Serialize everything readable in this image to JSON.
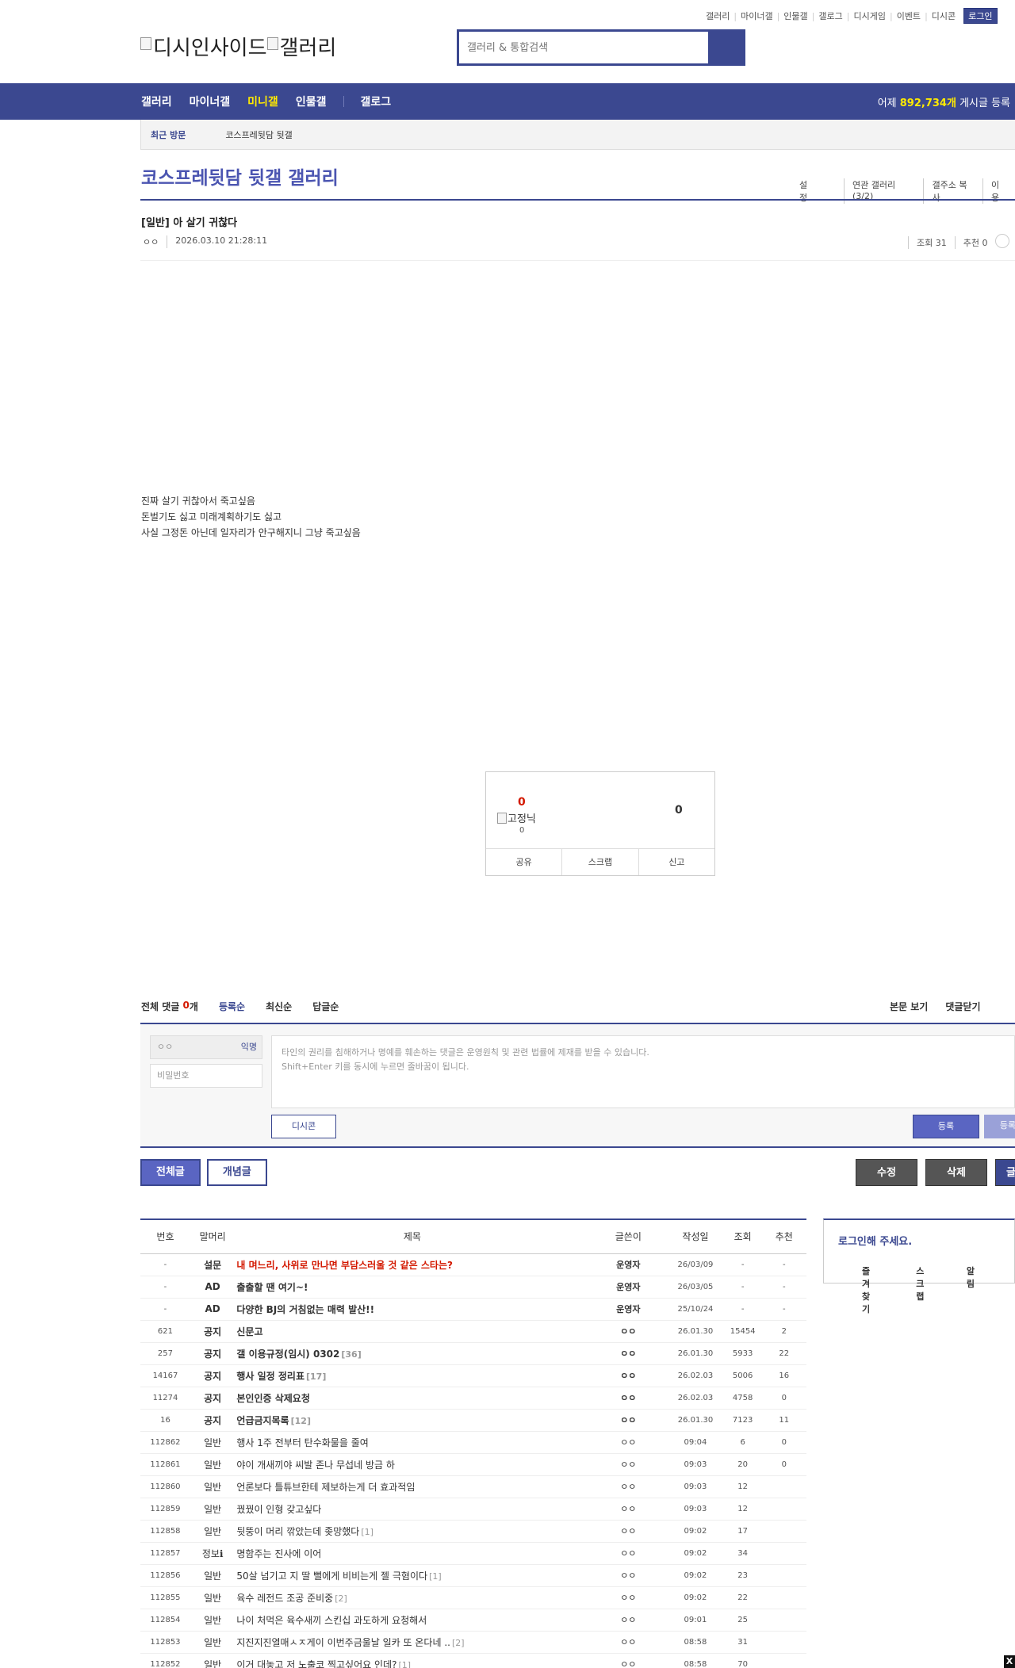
{
  "util_nav": {
    "items": [
      "갤러리",
      "마이너갤",
      "인물갤",
      "갤로그",
      "디시게임",
      "이벤트",
      "디시콘"
    ],
    "login": "로그인"
  },
  "logo": {
    "site": "디시인사이드",
    "gallery": "갤러리"
  },
  "search": {
    "placeholder": "갤러리 & 통합검색"
  },
  "gnb": {
    "menu": [
      "갤러리",
      "마이너갤",
      "미니갤",
      "인물갤",
      "갤로그"
    ],
    "active_index": 2,
    "stat_prefix": "어제",
    "stat_value": "892,734개",
    "stat_suffix": "게시글 등록"
  },
  "recent": {
    "label": "최근 방문",
    "item": "코스프레뒷담 뒷갤"
  },
  "gallery": {
    "title": "코스프레뒷담 뒷갤 갤러리",
    "tools": [
      "설정",
      "연관 갤러리(3/2)",
      "갤주소 복사",
      "이용"
    ]
  },
  "post": {
    "title": "[일반] 아 살기 귀찮다",
    "writer": "ㅇㅇ",
    "date": "2026.03.10 21:28:11",
    "views": "조회 31",
    "recommend": "추천 0",
    "content": [
      "진짜 살기 귀찮아서 죽고싶음",
      "돈벌기도 싫고 미래계획하기도 싫고",
      "사실 그정돈 아닌데 일자리가 안구해지니 그냥 죽고싶음"
    ]
  },
  "rec_box": {
    "up_count": "0",
    "fixed_label": "고정닉",
    "fixed_count": "0",
    "down_count": "0",
    "buttons": [
      "공유",
      "스크랩",
      "신고"
    ]
  },
  "comments": {
    "total_label": "전체 댓글",
    "count": "0",
    "unit": "개",
    "sorts": [
      "등록순",
      "최신순",
      "답글순"
    ],
    "right_links": [
      "본문 보기",
      "댓글닫기"
    ],
    "nick_value": "ㅇㅇ",
    "anon_label": "익명",
    "password_placeholder": "비밀번호",
    "textarea_line1": "타인의 권리를 침해하거나 명예를 훼손하는 댓글은 운영원칙 및 관련 법률에 제재를 받을 수 있습니다.",
    "textarea_line2": "Shift+Enter 키를 동시에 누르면 줄바꿈이 됩니다.",
    "dccon_button": "디시콘",
    "submit_button": "등록",
    "submit2_button": "등록"
  },
  "list_tabs": [
    "전체글",
    "개념글"
  ],
  "actions": [
    "수정",
    "삭제",
    "글"
  ],
  "table": {
    "headers": [
      "번호",
      "말머리",
      "제목",
      "글쓴이",
      "작성일",
      "조회",
      "추천"
    ],
    "rows": [
      {
        "num": "-",
        "head": "설문",
        "subject": "내 며느리, 사위로 만나면 부담스러울 것 같은 스타는?",
        "reply": "",
        "writer": "운영자",
        "date": "26/03/09",
        "views": "-",
        "rec": "-",
        "type": "red"
      },
      {
        "num": "-",
        "head": "AD",
        "subject": "출출할 땐 여기~!",
        "reply": "",
        "writer": "운영자",
        "date": "26/03/05",
        "views": "-",
        "rec": "-",
        "type": "notice"
      },
      {
        "num": "-",
        "head": "AD",
        "subject": "다양한 BJ의 거침없는 매력 발산!!",
        "reply": "",
        "writer": "운영자",
        "date": "25/10/24",
        "views": "-",
        "rec": "-",
        "type": "notice"
      },
      {
        "num": "621",
        "head": "공지",
        "subject": "신문고",
        "reply": "",
        "writer": "ㅇㅇ",
        "date": "26.01.30",
        "views": "15454",
        "rec": "2",
        "type": "notice"
      },
      {
        "num": "257",
        "head": "공지",
        "subject": "갤 이용규정(임시) 0302",
        "reply": "[36]",
        "writer": "ㅇㅇ",
        "date": "26.01.30",
        "views": "5933",
        "rec": "22",
        "type": "notice"
      },
      {
        "num": "14167",
        "head": "공지",
        "subject": "행사 일정 정리표",
        "reply": "[17]",
        "writer": "ㅇㅇ",
        "date": "26.02.03",
        "views": "5006",
        "rec": "16",
        "type": "notice"
      },
      {
        "num": "11274",
        "head": "공지",
        "subject": "본인인증 삭제요청",
        "reply": "",
        "writer": "ㅇㅇ",
        "date": "26.02.03",
        "views": "4758",
        "rec": "0",
        "type": "notice"
      },
      {
        "num": "16",
        "head": "공지",
        "subject": "언급금지목록",
        "reply": "[12]",
        "writer": "ㅇㅇ",
        "date": "26.01.30",
        "views": "7123",
        "rec": "11",
        "type": "notice"
      },
      {
        "num": "112862",
        "head": "일반",
        "subject": "행사 1주 전부터 탄수화물을 줄여",
        "reply": "",
        "writer": "ㅇㅇ",
        "date": "09:04",
        "views": "6",
        "rec": "0",
        "type": "normal"
      },
      {
        "num": "112861",
        "head": "일반",
        "subject": "야이 개새끼야 씨발 존나 무섭네 방금 하",
        "reply": "",
        "writer": "ㅇㅇ",
        "date": "09:03",
        "views": "20",
        "rec": "0",
        "type": "normal"
      },
      {
        "num": "112860",
        "head": "일반",
        "subject": "언론보다 틀튜브한테 제보하는게 더 효과적임",
        "reply": "",
        "writer": "ㅇㅇ",
        "date": "09:03",
        "views": "12",
        "rec": "",
        "type": "normal"
      },
      {
        "num": "112859",
        "head": "일반",
        "subject": "꿨꿨이 인형 갖고싶다",
        "reply": "",
        "writer": "ㅇㅇ",
        "date": "09:03",
        "views": "12",
        "rec": "",
        "type": "normal"
      },
      {
        "num": "112858",
        "head": "일반",
        "subject": "뒷뚱이 머리 깎았는데 좆망했다",
        "reply": "[1]",
        "writer": "ㅇㅇ",
        "date": "09:02",
        "views": "17",
        "rec": "",
        "type": "normal"
      },
      {
        "num": "112857",
        "head": "정보ℹ",
        "subject": "명함주는 진사에 이어",
        "reply": "",
        "writer": "ㅇㅇ",
        "date": "09:02",
        "views": "34",
        "rec": "",
        "type": "normal"
      },
      {
        "num": "112856",
        "head": "일반",
        "subject": "50살 넘기고 지 딸 뻘에게 비비는게 젤 극혐이다",
        "reply": "[1]",
        "writer": "ㅇㅇ",
        "date": "09:02",
        "views": "23",
        "rec": "",
        "type": "normal"
      },
      {
        "num": "112855",
        "head": "일반",
        "subject": "육수 레전드 조공 준비중",
        "reply": "[2]",
        "writer": "ㅇㅇ",
        "date": "09:02",
        "views": "22",
        "rec": "",
        "type": "normal"
      },
      {
        "num": "112854",
        "head": "일반",
        "subject": "나이 처먹은 육수새끼 스킨십 과도하게 요청해서",
        "reply": "",
        "writer": "ㅇㅇ",
        "date": "09:01",
        "views": "25",
        "rec": "",
        "type": "normal"
      },
      {
        "num": "112853",
        "head": "일반",
        "subject": "지진지진열매ㅅㅈ게이 이번주금울날 일카 또 온다네 ..",
        "reply": "[2]",
        "writer": "ㅇㅇ",
        "date": "08:58",
        "views": "31",
        "rec": "",
        "type": "normal"
      },
      {
        "num": "112852",
        "head": "일반",
        "subject": "이거 대놓고 저 노출코 찍고싶어요 인데?",
        "reply": "[1]",
        "writer": "ㅇㅇ",
        "date": "08:58",
        "views": "70",
        "rec": "",
        "type": "normal"
      }
    ]
  },
  "side_box": {
    "title": "로그인해 주세요.",
    "links": [
      "즐겨찾기",
      "스크랩",
      "알림"
    ]
  },
  "close_label": "X",
  "colors": {
    "brand": "#3b4890",
    "accent": "#ffea00",
    "red": "#d31900"
  }
}
